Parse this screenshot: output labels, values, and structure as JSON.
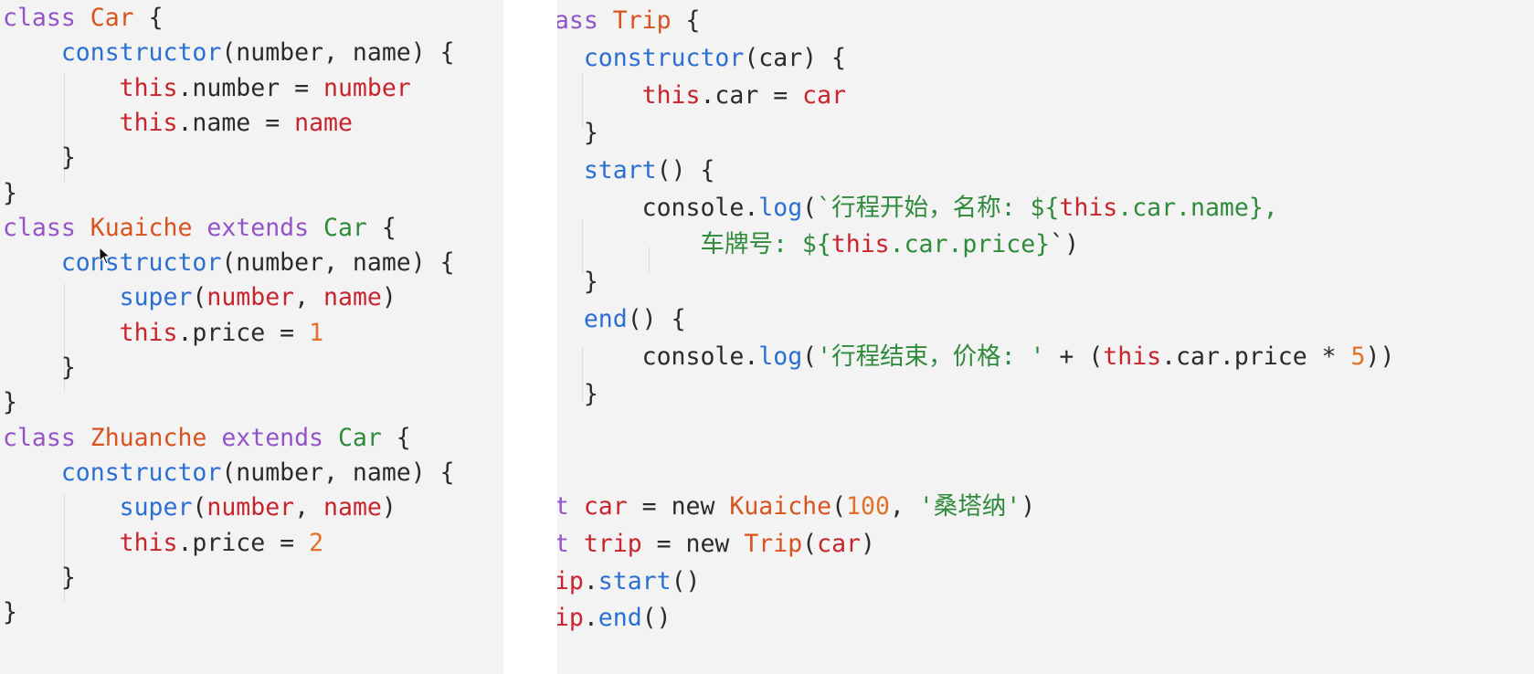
{
  "colors": {
    "panel_bg": "#f3f3f3",
    "keyword": "#9354c8",
    "class_name": "#d8531e",
    "superclass": "#2f8a3c",
    "function": "#2a6fd1",
    "this_param": "#c8242d",
    "number": "#e1712a",
    "string": "#2f8a3c",
    "plain": "#2b2b2b"
  },
  "left_code": [
    [
      [
        "kw",
        "class "
      ],
      [
        "cls",
        "Car"
      ],
      [
        "plain",
        " {"
      ]
    ],
    [
      [
        "plain",
        "    "
      ],
      [
        "fn",
        "constructor"
      ],
      [
        "plain",
        "(number, name) {"
      ]
    ],
    [
      [
        "plain",
        "        "
      ],
      [
        "this",
        "this"
      ],
      [
        "plain",
        ".number = "
      ],
      [
        "param",
        "number"
      ]
    ],
    [
      [
        "plain",
        "        "
      ],
      [
        "this",
        "this"
      ],
      [
        "plain",
        ".name = "
      ],
      [
        "param",
        "name"
      ]
    ],
    [
      [
        "plain",
        "    }"
      ]
    ],
    [
      [
        "plain",
        "}"
      ]
    ],
    [
      [
        "kw",
        "class "
      ],
      [
        "cls",
        "Kuaiche"
      ],
      [
        "kw",
        " extends "
      ],
      [
        "super",
        "Car"
      ],
      [
        "plain",
        " {"
      ]
    ],
    [
      [
        "plain",
        "    "
      ],
      [
        "fn",
        "constructor"
      ],
      [
        "plain",
        "(number, name) {"
      ]
    ],
    [
      [
        "plain",
        "        "
      ],
      [
        "fn",
        "super"
      ],
      [
        "plain",
        "("
      ],
      [
        "param",
        "number"
      ],
      [
        "plain",
        ", "
      ],
      [
        "param",
        "name"
      ],
      [
        "plain",
        ")"
      ]
    ],
    [
      [
        "plain",
        "        "
      ],
      [
        "this",
        "this"
      ],
      [
        "plain",
        ".price = "
      ],
      [
        "num",
        "1"
      ]
    ],
    [
      [
        "plain",
        "    }"
      ]
    ],
    [
      [
        "plain",
        "}"
      ]
    ],
    [
      [
        "kw",
        "class "
      ],
      [
        "cls",
        "Zhuanche"
      ],
      [
        "kw",
        " extends "
      ],
      [
        "super",
        "Car"
      ],
      [
        "plain",
        " {"
      ]
    ],
    [
      [
        "plain",
        "    "
      ],
      [
        "fn",
        "constructor"
      ],
      [
        "plain",
        "(number, name) {"
      ]
    ],
    [
      [
        "plain",
        "        "
      ],
      [
        "fn",
        "super"
      ],
      [
        "plain",
        "("
      ],
      [
        "param",
        "number"
      ],
      [
        "plain",
        ", "
      ],
      [
        "param",
        "name"
      ],
      [
        "plain",
        ")"
      ]
    ],
    [
      [
        "plain",
        "        "
      ],
      [
        "this",
        "this"
      ],
      [
        "plain",
        ".price = "
      ],
      [
        "num",
        "2"
      ]
    ],
    [
      [
        "plain",
        "    }"
      ]
    ],
    [
      [
        "plain",
        "}"
      ]
    ]
  ],
  "right_code": [
    [
      [
        "kw",
        "class "
      ],
      [
        "cls",
        "Trip"
      ],
      [
        "plain",
        " {"
      ]
    ],
    [
      [
        "plain",
        "    "
      ],
      [
        "fn",
        "constructor"
      ],
      [
        "plain",
        "(car) {"
      ]
    ],
    [
      [
        "plain",
        "        "
      ],
      [
        "this",
        "this"
      ],
      [
        "plain",
        ".car = "
      ],
      [
        "param",
        "car"
      ]
    ],
    [
      [
        "plain",
        "    }"
      ]
    ],
    [
      [
        "plain",
        "    "
      ],
      [
        "fn",
        "start"
      ],
      [
        "plain",
        "() {"
      ]
    ],
    [
      [
        "plain",
        "        console."
      ],
      [
        "fn",
        "log"
      ],
      [
        "plain",
        "("
      ],
      [
        "str",
        "`行程开始，名称: ${"
      ],
      [
        "this",
        "this"
      ],
      [
        "str",
        ".car.name},"
      ]
    ],
    [
      [
        "str",
        "            车牌号: ${"
      ],
      [
        "this",
        "this"
      ],
      [
        "str",
        ".car.price}"
      ],
      [
        "plain",
        "`)"
      ]
    ],
    [
      [
        "plain",
        "    }"
      ]
    ],
    [
      [
        "plain",
        "    "
      ],
      [
        "fn",
        "end"
      ],
      [
        "plain",
        "() {"
      ]
    ],
    [
      [
        "plain",
        "        console."
      ],
      [
        "fn",
        "log"
      ],
      [
        "plain",
        "("
      ],
      [
        "str",
        "'行程结束，价格: '"
      ],
      [
        "plain",
        " + ("
      ],
      [
        "this",
        "this"
      ],
      [
        "plain",
        ".car.price * "
      ],
      [
        "num",
        "5"
      ],
      [
        "plain",
        "))"
      ]
    ],
    [
      [
        "plain",
        "    }"
      ]
    ],
    [
      [
        "plain",
        "}"
      ]
    ],
    [
      [
        "plain",
        ""
      ]
    ],
    [
      [
        "kw",
        "let "
      ],
      [
        "this",
        "car"
      ],
      [
        "plain",
        " = new "
      ],
      [
        "cls",
        "Kuaiche"
      ],
      [
        "plain",
        "("
      ],
      [
        "num",
        "100"
      ],
      [
        "plain",
        ", "
      ],
      [
        "str",
        "'桑塔纳'"
      ],
      [
        "plain",
        ")"
      ]
    ],
    [
      [
        "kw",
        "let "
      ],
      [
        "this",
        "trip"
      ],
      [
        "plain",
        " = new "
      ],
      [
        "cls",
        "Trip"
      ],
      [
        "plain",
        "("
      ],
      [
        "this",
        "car"
      ],
      [
        "plain",
        ")"
      ]
    ],
    [
      [
        "this",
        "trip"
      ],
      [
        "plain",
        "."
      ],
      [
        "fn",
        "start"
      ],
      [
        "plain",
        "()"
      ]
    ],
    [
      [
        "this",
        "trip"
      ],
      [
        "plain",
        "."
      ],
      [
        "fn",
        "end"
      ],
      [
        "plain",
        "()"
      ]
    ]
  ]
}
